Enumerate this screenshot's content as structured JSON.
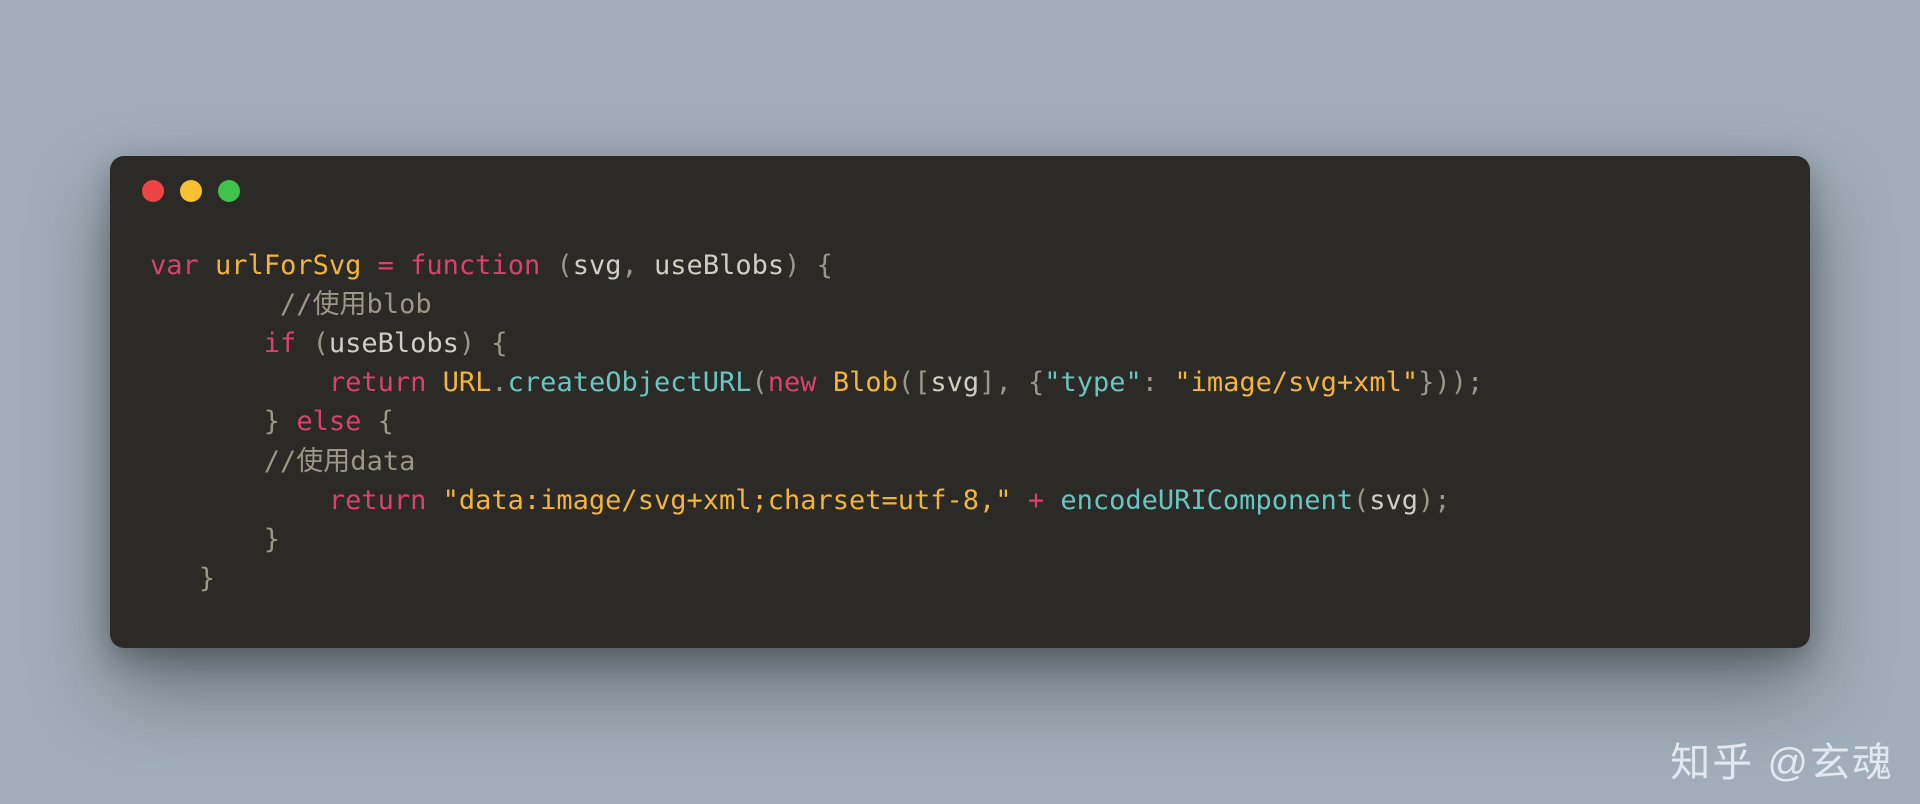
{
  "colors": {
    "background": "#a1adb8",
    "window_bg": "#2b2a27",
    "dot_red": "#ed4444",
    "dot_yellow": "#f8c132",
    "dot_green": "#3fc24a",
    "kw": "#d9426a",
    "name": "#f2b43a",
    "method": "#68c6c0",
    "punct": "#9b9688",
    "text": "#d1cdc2",
    "comment": "#9b9688"
  },
  "titlebar": {
    "close": "",
    "minimize": "",
    "zoom": ""
  },
  "code": {
    "l1": {
      "var": "var",
      "sp1": " ",
      "name": "urlForSvg",
      "sp2": " ",
      "eq": "=",
      "sp3": " ",
      "fn": "function",
      "sp4": " ",
      "lp": "(",
      "p1": "svg",
      "comma": ",",
      "sp5": " ",
      "p2": "useBlobs",
      "rp": ")",
      "sp6": " ",
      "lb": "{"
    },
    "l2": {
      "indent": "        ",
      "comment": "//使用blob"
    },
    "l3": {
      "indent": "       ",
      "if": "if",
      "sp1": " ",
      "lp": "(",
      "cond": "useBlobs",
      "rp": ")",
      "sp2": " ",
      "lb": "{"
    },
    "l4": {
      "indent": "           ",
      "ret": "return",
      "sp1": " ",
      "cls": "URL",
      "dot": ".",
      "method": "createObjectURL",
      "lp": "(",
      "new": "new",
      "sp2": " ",
      "blob": "Blob",
      "lp2": "(",
      "lbr": "[",
      "arg": "svg",
      "rbr": "]",
      "comma": ",",
      "sp3": " ",
      "lcb": "{",
      "key": "\"type\"",
      "colon": ":",
      "sp4": " ",
      "val": "\"image/svg+xml\"",
      "rcb": "}",
      "rp2": ")",
      "rp": ")",
      "semi": ";"
    },
    "l5": {
      "indent": "       ",
      "rb": "}",
      "sp1": " ",
      "else": "else",
      "sp2": " ",
      "lb": "{"
    },
    "l6": {
      "indent": "       ",
      "comment": "//使用data"
    },
    "l7": {
      "indent": "           ",
      "ret": "return",
      "sp1": " ",
      "str": "\"data:image/svg+xml;charset=utf-8,\"",
      "sp2": " ",
      "plus": "+",
      "sp3": " ",
      "fn": "encodeURIComponent",
      "lp": "(",
      "arg": "svg",
      "rp": ")",
      "semi": ";"
    },
    "l8": {
      "indent": "       ",
      "rb": "}"
    },
    "l9": {
      "indent": "   ",
      "rb": "}"
    }
  },
  "watermark": "知乎 @玄魂"
}
